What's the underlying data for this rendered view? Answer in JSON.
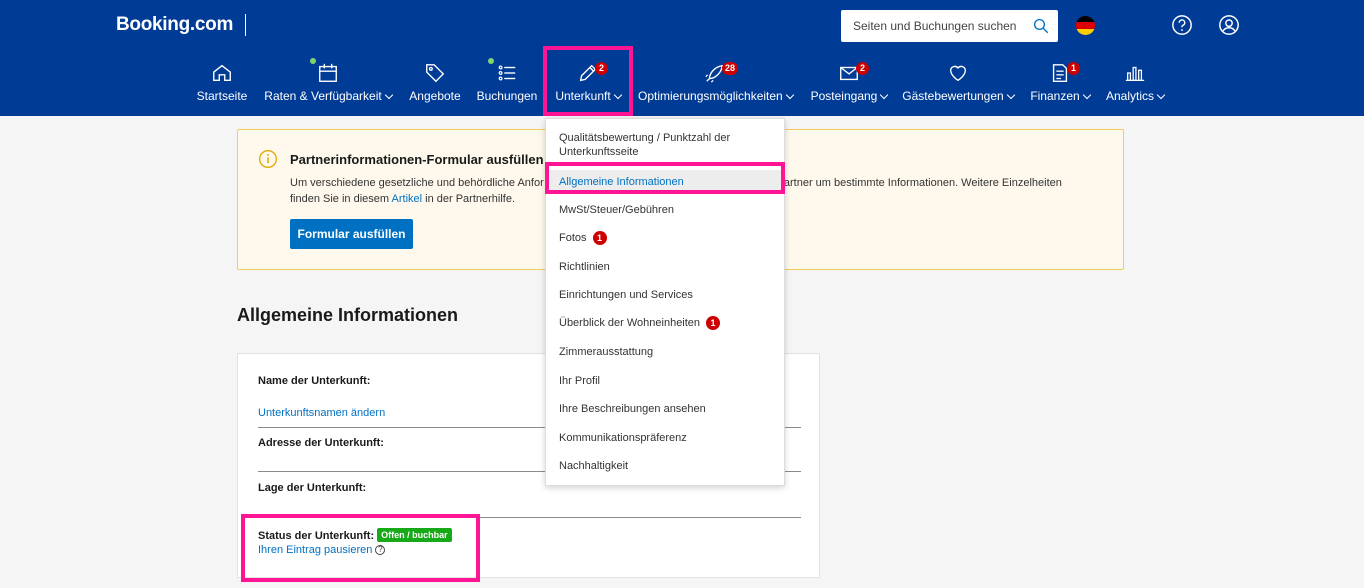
{
  "header": {
    "logo": "Booking.com",
    "search_placeholder": "Seiten und Buchungen suchen"
  },
  "nav": [
    {
      "label": "Startseite"
    },
    {
      "label": "Raten & Verfügbarkeit"
    },
    {
      "label": "Angebote"
    },
    {
      "label": "Buchungen"
    },
    {
      "label": "Unterkunft",
      "badge": "2"
    },
    {
      "label": "Optimierungsmöglichkeiten",
      "badge": "28"
    },
    {
      "label": "Posteingang",
      "badge": "2"
    },
    {
      "label": "Gästebewertungen"
    },
    {
      "label": "Finanzen",
      "badge": "1"
    },
    {
      "label": "Analytics"
    }
  ],
  "alert": {
    "title": "Partnerinformationen-Formular ausfüllen",
    "body_prefix": "Um verschiedene gesetzliche und behördliche Anfor",
    "body_suffix": "partner um bestimmte Informationen. Weitere Einzelheiten",
    "body_line2_prefix": "finden Sie in diesem ",
    "body_link": "Artikel",
    "body_line2_suffix": " in der Partnerhilfe.",
    "button": "Formular ausfüllen"
  },
  "page": {
    "title": "Allgemeine Informationen"
  },
  "card": {
    "name_label": "Name der Unterkunft:",
    "name_link": "Unterkunftsnamen ändern",
    "address_label": "Adresse der Unterkunft:",
    "location_label": "Lage der Unterkunft:",
    "status_label": "Status der Unterkunft:",
    "status_badge": "Offen / buchbar",
    "pause_link": "Ihren Eintrag pausieren",
    "help": "?"
  },
  "dropdown": {
    "items": [
      {
        "label": "Qualitätsbewertung / Punktzahl der Unterkunftsseite"
      },
      {
        "label": "Allgemeine Informationen"
      },
      {
        "label": "MwSt/Steuer/Gebühren"
      },
      {
        "label": "Fotos",
        "badge": "1"
      },
      {
        "label": "Richtlinien"
      },
      {
        "label": "Einrichtungen und Services"
      },
      {
        "label": "Überblick der Wohneinheiten",
        "badge": "1"
      },
      {
        "label": "Zimmerausstattung"
      },
      {
        "label": "Ihr Profil"
      },
      {
        "label": "Ihre Beschreibungen ansehen"
      },
      {
        "label": "Kommunikationspräferenz"
      },
      {
        "label": "Nachhaltigkeit"
      }
    ]
  },
  "colors": {
    "brand_blue": "#003b95",
    "link_blue": "#0071c2",
    "highlight": "#ff1493",
    "status_green": "#18a918",
    "badge_red": "#cc0000"
  }
}
